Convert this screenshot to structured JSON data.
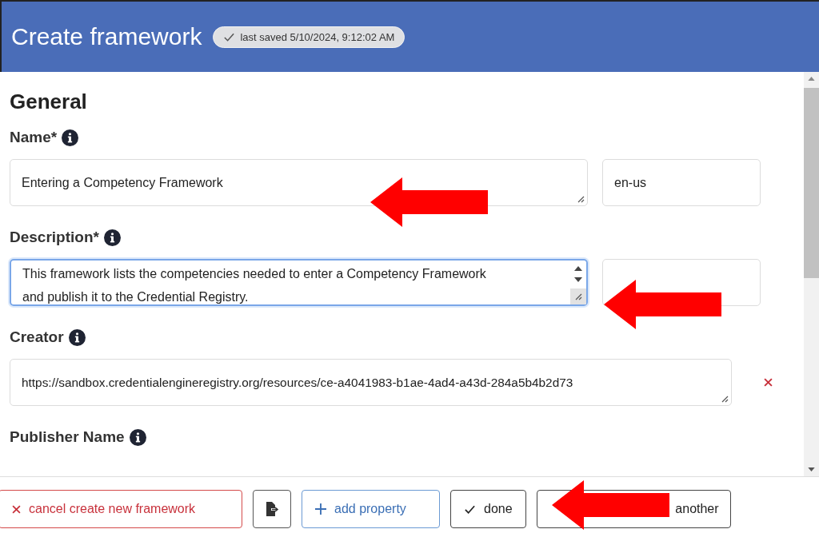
{
  "header": {
    "title": "Create framework",
    "saved_badge": "last saved 5/10/2024, 9:12:02 AM"
  },
  "section": {
    "title": "General"
  },
  "fields": [
    {
      "label": "Name*",
      "info": true,
      "kind": "textarea",
      "value": [
        "Entering a Competency Framework"
      ],
      "focused": false,
      "has_language": true,
      "language": "en-us",
      "removable": false
    },
    {
      "label": "Description*",
      "info": true,
      "kind": "textarea",
      "value": [
        "This framework lists the competencies needed to enter a Competency Framework",
        "and publish it to the Credential Registry."
      ],
      "focused": true,
      "has_language": true,
      "removable": false
    },
    {
      "label": "Creator",
      "info": true,
      "kind": "textarea",
      "value": [
        "https://sandbox.credentialengineregistry.org/resources/ce-a4041983-b1ae-4ad4-a43d-284a5b4b2d73"
      ],
      "focused": false,
      "has_language": false,
      "removable": true
    },
    {
      "label": "Publisher Name",
      "info": true,
      "kind": "label_only"
    }
  ],
  "actions": [
    {
      "kind": "danger",
      "label": "cancel create new framework"
    },
    {
      "kind": "export"
    },
    {
      "kind": "primary",
      "label": "add property"
    },
    {
      "kind": "done",
      "label": "done"
    },
    {
      "kind": "covered",
      "label": "another"
    }
  ],
  "annotations": [
    {
      "kind": "arrow"
    },
    {
      "kind": "arrow"
    },
    {
      "kind": "arrow"
    }
  ]
}
